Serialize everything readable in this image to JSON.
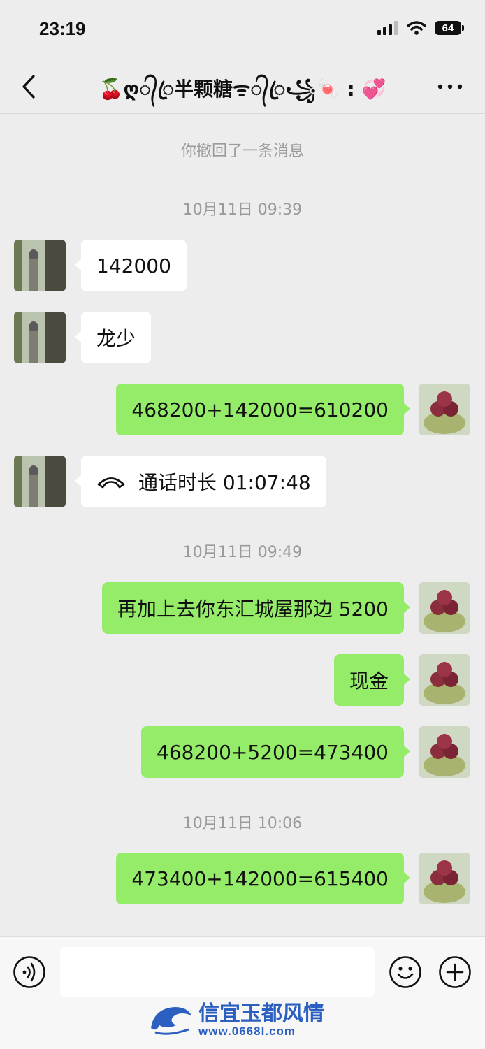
{
  "status": {
    "time": "23:19",
    "battery": "64"
  },
  "header": {
    "title": "🍒ღ᭄ꦿ半颗糖ᯤ᭄ꦿ꧁🍬 : 💞"
  },
  "system": {
    "recall_notice": "你撤回了一条消息"
  },
  "timestamps": [
    "10月11日 09:39",
    "10月11日 09:49",
    "10月11日 10:06"
  ],
  "messages": [
    {
      "side": "in",
      "text": "142000"
    },
    {
      "side": "in",
      "text": "龙少"
    },
    {
      "side": "out",
      "text": "468200+142000=610200"
    },
    {
      "side": "in",
      "call_label": "通话时长 01:07:48",
      "icon": "phone-handset-icon"
    },
    {
      "side": "out",
      "text": "再加上去你东汇城屋那边 5200"
    },
    {
      "side": "out",
      "text": "现金"
    },
    {
      "side": "out",
      "text": "468200+5200=473400"
    },
    {
      "side": "out",
      "text": "473400+142000=615400"
    }
  ],
  "composer": {
    "watermark_title": "信宜玉都风情",
    "watermark_url": "www.0668l.com"
  },
  "colors": {
    "outgoing_bubble": "#95ec69",
    "incoming_bubble": "#ffffff",
    "background": "#ededed"
  }
}
